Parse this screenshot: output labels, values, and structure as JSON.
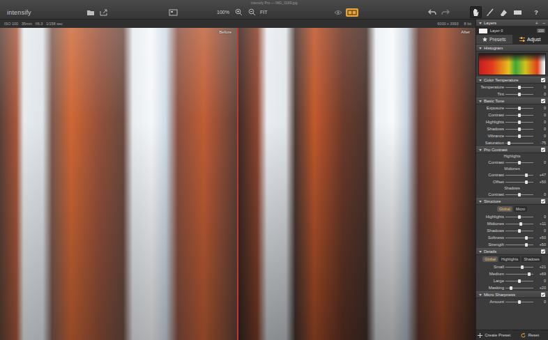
{
  "window": {
    "title": "Intensify Pro — IMG_0189.jpg"
  },
  "toolbar": {
    "logo": "intensify",
    "zoom": "100%",
    "fit": "FIT",
    "help": "?",
    "split_view_selected": true,
    "tools": [
      {
        "selected": true
      },
      {
        "selected": false
      },
      {
        "selected": false
      },
      {
        "selected": false
      }
    ]
  },
  "infobar": {
    "exif": "ISO 100   35mm   f/6.3   1/158 sec",
    "dimensions": "6000 x 3993",
    "bits": "8 bit"
  },
  "photos": {
    "before": "Before",
    "after": "After"
  },
  "layers": {
    "title": "Layers",
    "add": "+",
    "remove": "−",
    "items": [
      {
        "name": "Layer 0",
        "opacity": "100",
        "selected": true
      }
    ]
  },
  "panel_tabs": [
    {
      "label": "Presets",
      "selected": false
    },
    {
      "label": "Adjust",
      "selected": true
    }
  ],
  "histogram": {
    "title": "Histogram"
  },
  "sections": [
    {
      "title": "Color Temperature",
      "enabled": true,
      "items": [
        {
          "kind": "slider",
          "label": "Temperature",
          "value": "0",
          "level": 0.5
        },
        {
          "kind": "slider",
          "label": "Tint",
          "value": "0",
          "level": 0.5
        }
      ]
    },
    {
      "title": "Basic Tone",
      "enabled": true,
      "items": [
        {
          "kind": "slider",
          "label": "Exposure",
          "value": "0",
          "level": 0.5
        },
        {
          "kind": "slider",
          "label": "Contrast",
          "value": "0",
          "level": 0.5
        },
        {
          "kind": "slider",
          "label": "Highlights",
          "value": "0",
          "level": 0.5
        },
        {
          "kind": "slider",
          "label": "Shadows",
          "value": "0",
          "level": 0.5
        },
        {
          "kind": "slider",
          "label": "Vibrance",
          "value": "0",
          "level": 0.5
        },
        {
          "kind": "slider",
          "label": "Saturation",
          "value": "-75",
          "level": 0.13
        }
      ]
    },
    {
      "title": "Pro Contrast",
      "enabled": true,
      "items": [
        {
          "kind": "group",
          "label": "Highlights"
        },
        {
          "kind": "slider",
          "label": "Contrast",
          "value": "0",
          "level": 0.5
        },
        {
          "kind": "group",
          "label": "Midtones"
        },
        {
          "kind": "slider",
          "label": "Contrast",
          "value": "+47",
          "level": 0.74
        },
        {
          "kind": "slider",
          "label": "Offset",
          "value": "+50",
          "level": 0.75
        },
        {
          "kind": "group",
          "label": "Shadows"
        },
        {
          "kind": "slider",
          "label": "Contrast",
          "value": "0",
          "level": 0.5
        }
      ]
    },
    {
      "title": "Structure",
      "enabled": true,
      "items": [
        {
          "kind": "tabs",
          "tabs": [
            {
              "label": "Global",
              "selected": true
            },
            {
              "label": "Micro",
              "selected": false
            }
          ]
        },
        {
          "kind": "slider",
          "label": "Highlights",
          "value": "0",
          "level": 0.5
        },
        {
          "kind": "slider",
          "label": "Midtones",
          "value": "+11",
          "level": 0.56
        },
        {
          "kind": "slider",
          "label": "Shadows",
          "value": "0",
          "level": 0.5
        },
        {
          "kind": "slider",
          "label": "Softness",
          "value": "+50",
          "level": 0.75
        },
        {
          "kind": "slider",
          "label": "Strength",
          "value": "+50",
          "level": 0.75
        }
      ]
    },
    {
      "title": "Details",
      "enabled": true,
      "items": [
        {
          "kind": "tabs",
          "tabs": [
            {
              "label": "Global",
              "selected": true
            },
            {
              "label": "Highlights",
              "selected": false
            },
            {
              "label": "Shadows",
              "selected": false
            }
          ]
        },
        {
          "kind": "slider",
          "label": "Small",
          "value": "+21",
          "level": 0.6
        },
        {
          "kind": "slider",
          "label": "Medium",
          "value": "+69",
          "level": 0.85
        },
        {
          "kind": "slider",
          "label": "Large",
          "value": "0",
          "level": 0.5
        },
        {
          "kind": "slider",
          "label": "Masking",
          "value": "+20",
          "level": 0.2
        }
      ]
    },
    {
      "title": "Micro Sharpness",
      "enabled": true,
      "items": [
        {
          "kind": "slider",
          "label": "Amount",
          "value": "0",
          "level": 0.5
        }
      ]
    }
  ],
  "footer": {
    "create": "Create Preset",
    "reset": "Reset"
  }
}
